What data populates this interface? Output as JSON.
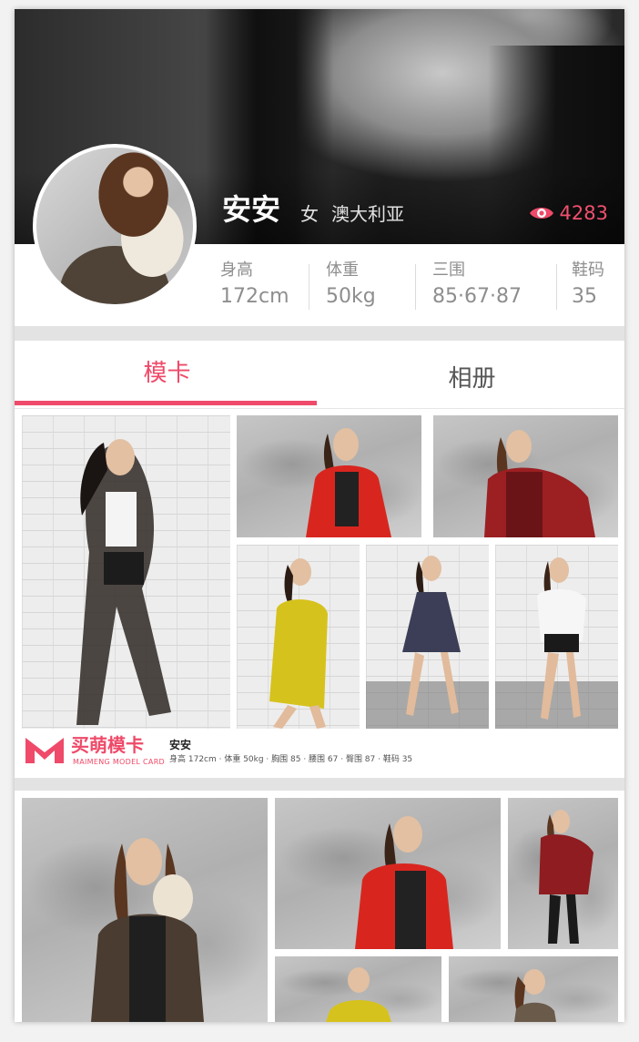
{
  "profile": {
    "name": "安安",
    "gender": "女",
    "country": "澳大利亚",
    "views": "4283"
  },
  "stats": [
    {
      "label": "身高",
      "value": "172cm"
    },
    {
      "label": "体重",
      "value": "50kg"
    },
    {
      "label": "三围",
      "value": "85·67·87"
    },
    {
      "label": "鞋码",
      "value": "35"
    }
  ],
  "tabs": [
    {
      "label": "模卡",
      "active": true
    },
    {
      "label": "相册",
      "active": false
    }
  ],
  "model_card": {
    "brand": "买萌模卡",
    "brand_sub": "MAIMENG MODEL CARD",
    "name": "安安",
    "stats_line": "身高 172cm  ·  体重 50kg  ·  胸围 85  ·  腰围 67  ·  臀围 87  ·  鞋码 35"
  },
  "colors": {
    "accent": "#ef4a69",
    "stat_text": "#8e8e8e",
    "divider": "#e3e3e3"
  },
  "icons": {
    "views": "eye-icon",
    "logo": "maimeng-logo-icon"
  }
}
